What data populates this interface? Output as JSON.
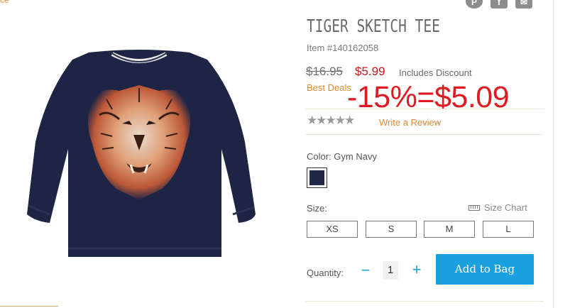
{
  "top_link": "ce",
  "share": {
    "pinterest_glyph": "P",
    "facebook_glyph": "f",
    "email_glyph": "✉"
  },
  "product": {
    "title": "TIGER SKETCH TEE",
    "item_number": "Item #140162058",
    "original_price": "$16.95",
    "sale_price": "$5.99",
    "discount_note": "Includes Discount",
    "deal_badge": "Best Deals",
    "annotation": "-15%=$5.09",
    "rating_stars": "★★★★★",
    "write_review": "Write a Review"
  },
  "color": {
    "label": "Color: Gym Navy",
    "swatch_hex": "#202846"
  },
  "size": {
    "label": "Size:",
    "chart_link": "Size Chart",
    "options": [
      "XS",
      "S",
      "M",
      "L"
    ]
  },
  "quantity": {
    "label": "Quantity:",
    "minus": "−",
    "value": "1",
    "plus": "+"
  },
  "cart": {
    "add_button": "Add to Bag"
  },
  "colors": {
    "accent": "#1aa0de",
    "sale": "#c8171e",
    "link": "#e0892d",
    "shirt": "#1e2444"
  }
}
